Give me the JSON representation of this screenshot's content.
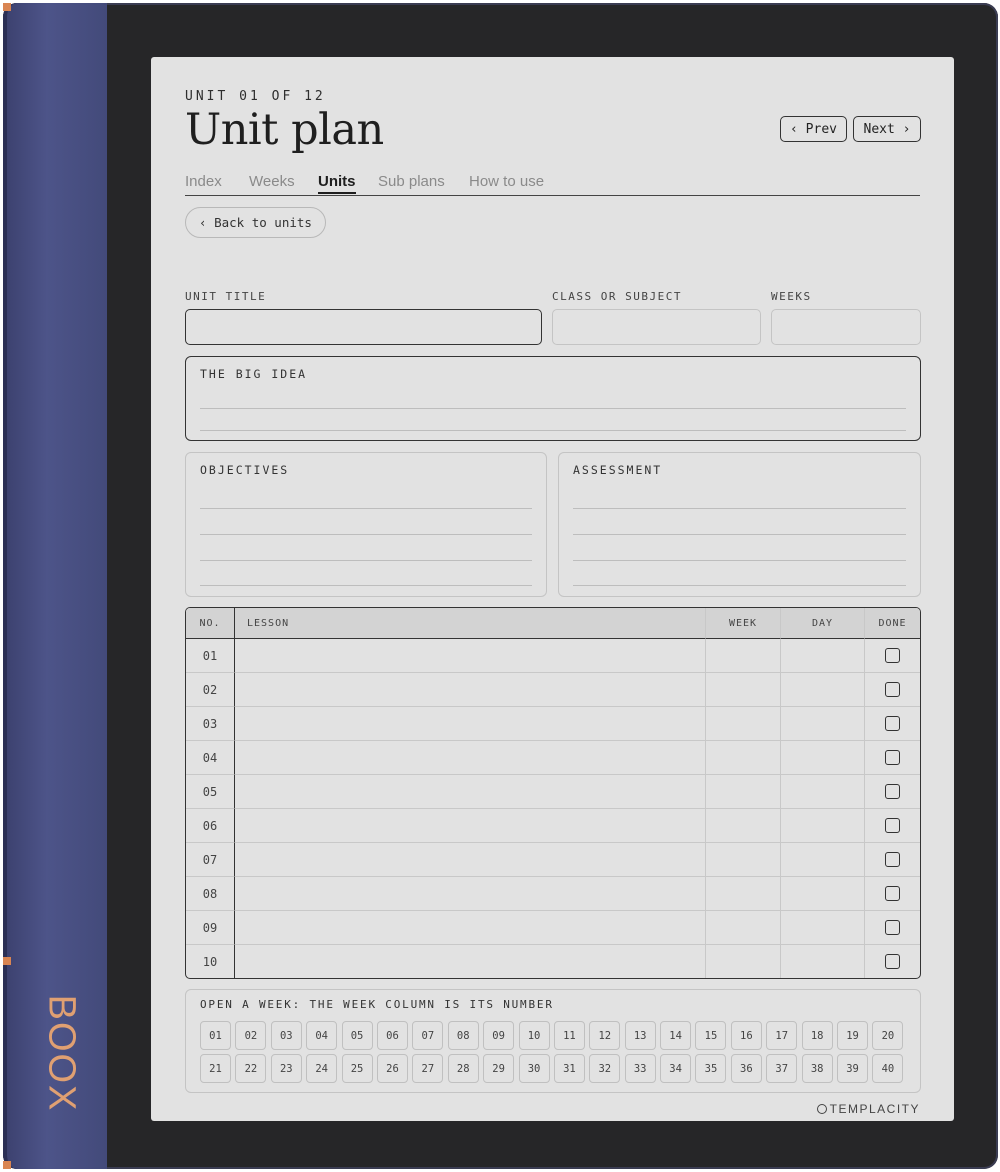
{
  "device": {
    "brand": "BOOX",
    "spine_color": "#474d82",
    "accent_color": "#d98552"
  },
  "header": {
    "eyebrow": "UNIT 01 OF 12",
    "title": "Unit plan"
  },
  "nav": {
    "prev": "‹ Prev",
    "next": "Next ›"
  },
  "tabs": [
    {
      "label": "Index",
      "active": false
    },
    {
      "label": "Weeks",
      "active": false
    },
    {
      "label": "Units",
      "active": true
    },
    {
      "label": "Sub plans",
      "active": false
    },
    {
      "label": "How to use",
      "active": false
    }
  ],
  "back_button": "‹ Back to units",
  "fields": {
    "unit_title": "UNIT TITLE",
    "class_subject": "CLASS OR SUBJECT",
    "weeks": "WEEKS"
  },
  "sections": {
    "big_idea": "THE BIG IDEA",
    "objectives": "OBJECTIVES",
    "assessment": "ASSESSMENT"
  },
  "table": {
    "headers": {
      "no": "NO.",
      "lesson": "LESSON",
      "week": "WEEK",
      "day": "DAY",
      "done": "DONE"
    },
    "rows": [
      "01",
      "02",
      "03",
      "04",
      "05",
      "06",
      "07",
      "08",
      "09",
      "10"
    ]
  },
  "week_picker": {
    "label": "OPEN A WEEK: THE WEEK COLUMN IS ITS NUMBER",
    "weeks": [
      "01",
      "02",
      "03",
      "04",
      "05",
      "06",
      "07",
      "08",
      "09",
      "10",
      "11",
      "12",
      "13",
      "14",
      "15",
      "16",
      "17",
      "18",
      "19",
      "20",
      "21",
      "22",
      "23",
      "24",
      "25",
      "26",
      "27",
      "28",
      "29",
      "30",
      "31",
      "32",
      "33",
      "34",
      "35",
      "36",
      "37",
      "38",
      "39",
      "40"
    ]
  },
  "footer": {
    "brand": "TEMPLACITY"
  }
}
